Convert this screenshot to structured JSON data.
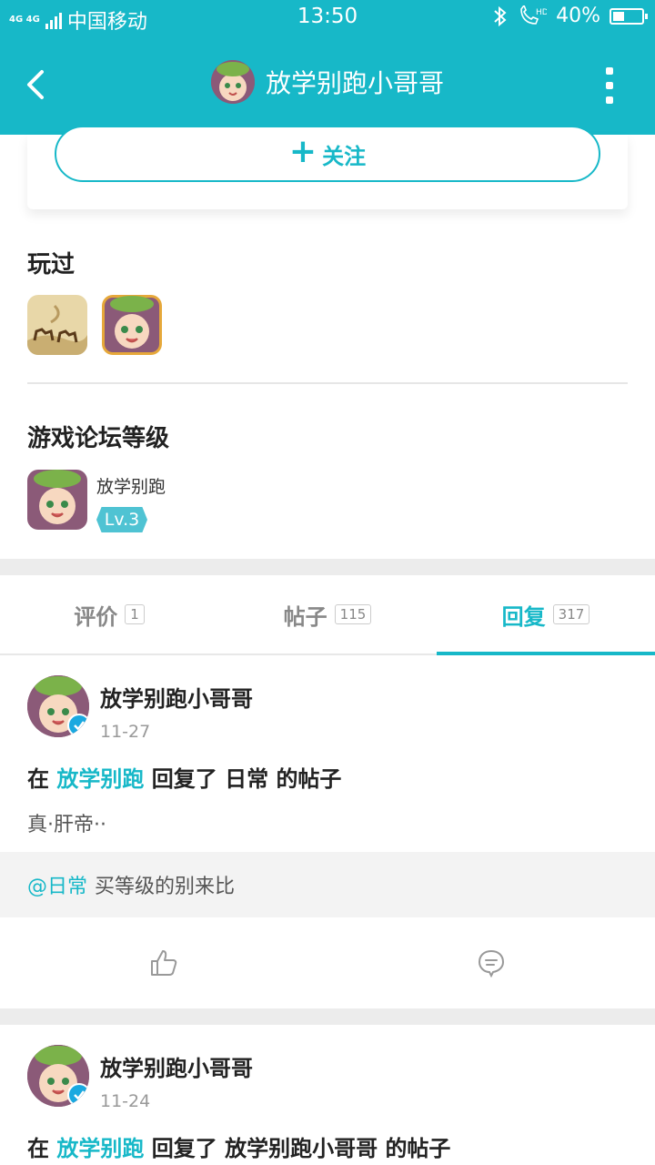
{
  "status": {
    "network": "4G 4G",
    "carrier": "中国移动",
    "time": "13:50",
    "battery_text": "40%",
    "battery_level": 0.4,
    "icons": [
      "bluetooth-icon",
      "hd-call-icon",
      "battery-icon"
    ]
  },
  "header": {
    "title": "放学别跑小哥哥",
    "back_icon": "chevron-left-icon",
    "more_icon": "more-vertical-icon"
  },
  "follow": {
    "label": "关注",
    "icon": "plus-icon"
  },
  "played": {
    "title": "玩过",
    "games": [
      "desert-caravan-game-icon",
      "anime-girl-game-icon"
    ]
  },
  "forum": {
    "title": "游戏论坛等级",
    "game_name": "放学别跑",
    "level": "Lv.3"
  },
  "tabs": [
    {
      "label": "评价",
      "count": "1"
    },
    {
      "label": "帖子",
      "count": "115"
    },
    {
      "label": "回复",
      "count": "317",
      "active": true
    }
  ],
  "posts": [
    {
      "author": "放学别跑小哥哥",
      "date": "11-27",
      "prefix": "在",
      "game": "放学别跑",
      "action": "回复了",
      "target": "日常",
      "suffix": "的帖子",
      "body": "真·肝帝··",
      "quote_mention": "@日常",
      "quote_text": "买等级的别来比"
    },
    {
      "author": "放学别跑小哥哥",
      "date": "11-24",
      "prefix": "在",
      "game": "放学别跑",
      "action": "回复了",
      "target": "放学别跑小哥哥",
      "suffix": "的帖子"
    }
  ],
  "colors": {
    "accent": "#17b8c8",
    "verified": "#1aa9e0",
    "level_badge": "#4fc3d3"
  }
}
